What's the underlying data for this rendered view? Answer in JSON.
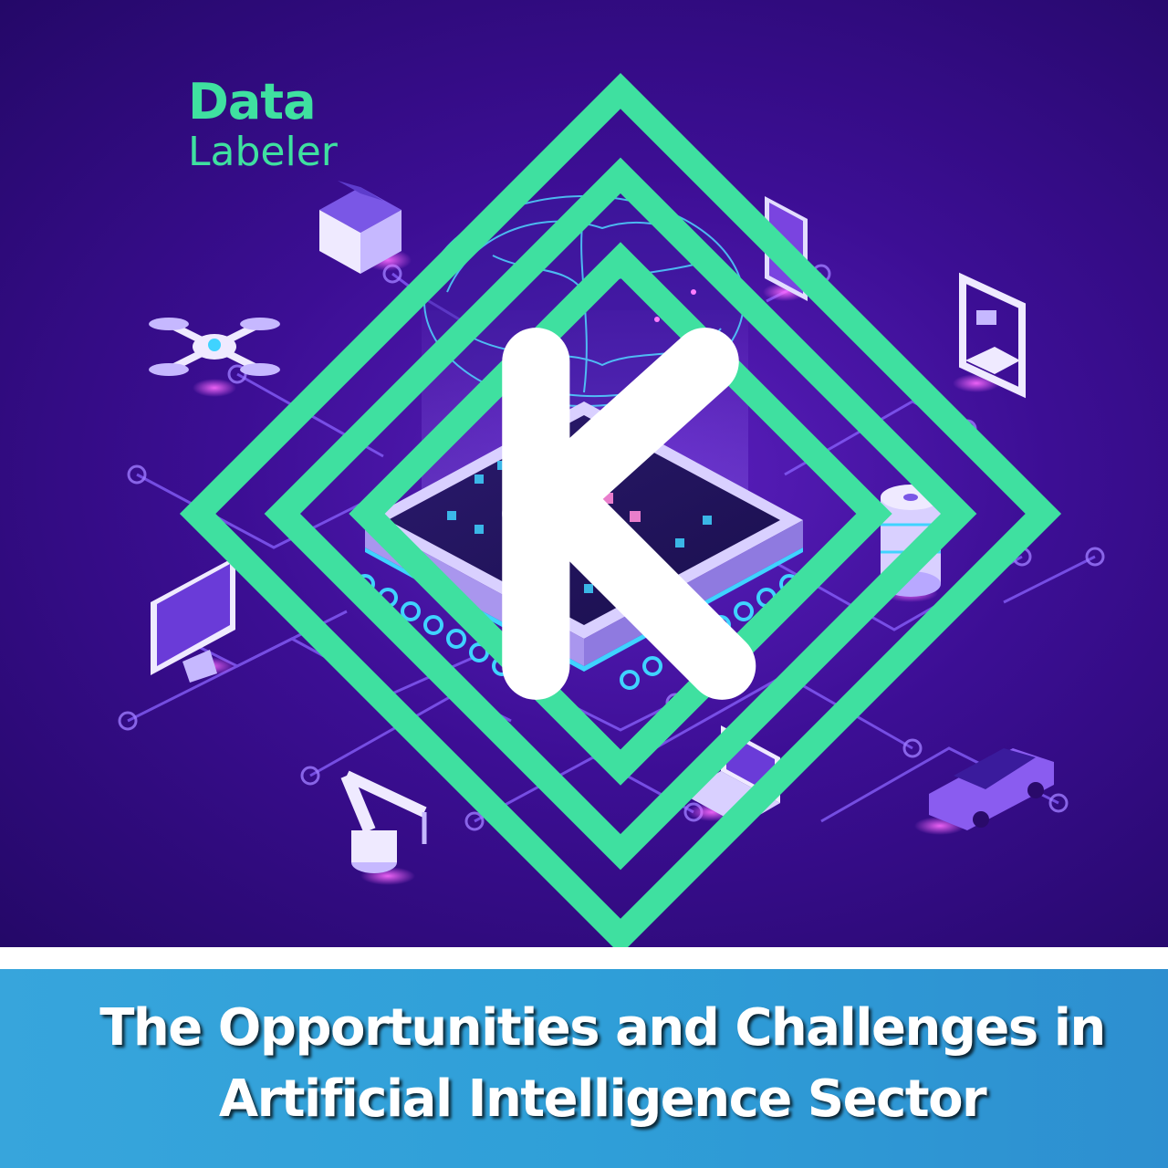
{
  "brand": {
    "name_line_1": "Data",
    "name_line_2": "Labeler",
    "logo_icon": "diamond-k-logo-icon",
    "color": "#3fe0a0"
  },
  "banner": {
    "title": "The Opportunities and Challenges in Artificial Intelligence Sector",
    "background_color": "#2f9fd8",
    "text_color": "#ffffff"
  },
  "illustration": {
    "background_color": "#3c0e94",
    "accent_color": "#3fd3ff",
    "glow_color": "#e040ff",
    "icons": [
      "house-icon",
      "smartphone-icon",
      "drone-icon",
      "3d-printer-icon",
      "brain-icon",
      "processor-chip-icon",
      "database-icon",
      "monitor-icon",
      "robotic-arm-icon",
      "laptop-icon",
      "car-icon"
    ]
  }
}
